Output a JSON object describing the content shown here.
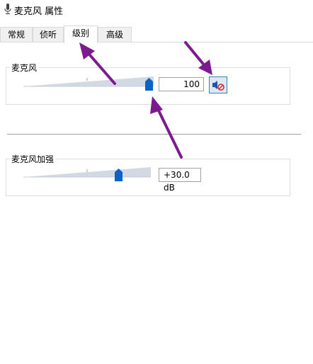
{
  "window": {
    "title": "麦克风 属性"
  },
  "tabs": [
    {
      "label": "常规",
      "active": false
    },
    {
      "label": "侦听",
      "active": false
    },
    {
      "label": "级别",
      "active": true
    },
    {
      "label": "高级",
      "active": false
    }
  ],
  "microphone": {
    "label": "麦克风",
    "level": 100,
    "value_text": "100",
    "muted_icon": "speaker-muted-icon"
  },
  "boost": {
    "label": "麦克风加强",
    "level_fraction": 0.67,
    "value_text": "+30.0 dB"
  },
  "colors": {
    "accent": "#0a64c8",
    "annotation_arrow": "#7b1b8f",
    "track_fill": "#d3d9e2"
  }
}
